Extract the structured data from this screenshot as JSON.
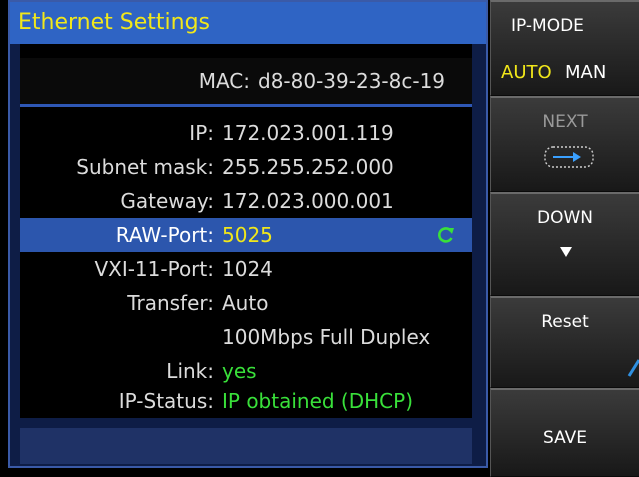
{
  "dialog": {
    "title": "Ethernet Settings",
    "mac": {
      "label": "MAC:",
      "value": "d8-80-39-23-8c-19"
    },
    "fields": [
      {
        "label": "IP:",
        "value": "172.023.001.119"
      },
      {
        "label": "Subnet mask:",
        "value": "255.255.252.000"
      },
      {
        "label": "Gateway:",
        "value": "172.023.000.001"
      },
      {
        "label": "RAW-Port:",
        "value": "5025"
      },
      {
        "label": "VXI-11-Port:",
        "value": "1024"
      },
      {
        "label": "Transfer:",
        "value": "Auto"
      },
      {
        "label": "",
        "value": "100Mbps Full Duplex"
      },
      {
        "label": "Link:",
        "value": "yes"
      },
      {
        "label": "IP-Status:",
        "value": "IP obtained (DHCP)"
      }
    ],
    "selected_field": "RAW-Port:"
  },
  "softkeys": {
    "ip_mode": {
      "label": "IP-MODE",
      "options": [
        "AUTO",
        "MAN"
      ],
      "selected": "AUTO"
    },
    "next": {
      "label": "NEXT",
      "icon": "next-arrow-icon"
    },
    "down": {
      "label": "DOWN",
      "icon": "down-triangle-icon"
    },
    "reset": {
      "label": "Reset",
      "icon": "rotary-knob-icon"
    },
    "save": {
      "label": "SAVE"
    }
  },
  "colors": {
    "title_bar": "#2f64c4",
    "title_text": "#f1e71a",
    "panel_bg": "#0e1d46",
    "selected_row": "#2c56ad",
    "value_yellow": "#f1e71a",
    "value_green": "#39e03a"
  }
}
